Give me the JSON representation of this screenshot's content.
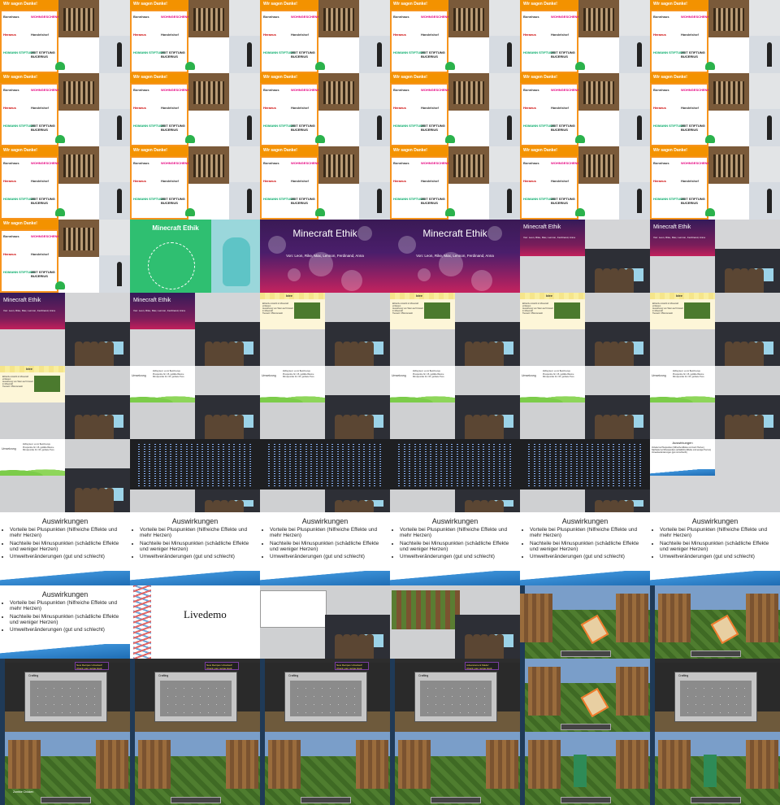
{
  "thanks": {
    "heading": "Wir sagen Danke!",
    "logos": [
      "Bonnhaus",
      "WOHNGESCHENK",
      "Heraeus",
      "Handelshof",
      "HOMANN STIFTUNG",
      "ZEIT STIFTUNG BUCERIUS"
    ]
  },
  "green_title": {
    "title": "Minecraft Ethik"
  },
  "purple_title": {
    "title": "Minecraft Ethik",
    "authors": "Von: Leon, Rike, Max, Lennon, Ferdinand, Anna"
  },
  "idee": {
    "title": "Idee",
    "bullets": [
      "Ethische Ansicht in Minecraft einbauen",
      "Auswirkung von Taten auf Umwelt",
      "in Minecraft",
      "Tierwelt / Pflanzenwelt"
    ]
  },
  "umsetzung": {
    "label": "Umsetzung",
    "lines": [
      "Zählsystem: es ist Belohnungs",
      "Pluspunkte für z.B. gefällte Bäume",
      "Minuspunkte für z.B. getötete Tiere"
    ]
  },
  "auswirkungen": {
    "title": "Auswirkungen",
    "bullets": [
      "Vorteile bei Pluspunkten (hilfreiche Effekte und mehr Herzen)",
      "Nachteile bei Minuspunkten (schädliche Effekte und weniger Herzen)",
      "Umweltveränderungen (gut und schlecht)"
    ]
  },
  "livedemo": {
    "title": "Livedemo"
  },
  "minecraft": {
    "advancement_toast": "New Recipes Unlocked!",
    "advancement_toast_sub": "Check your recipe book",
    "toast_2": "Advancement Made!",
    "inventory_title": "Crafting",
    "caption": "Zombie Chicken"
  }
}
